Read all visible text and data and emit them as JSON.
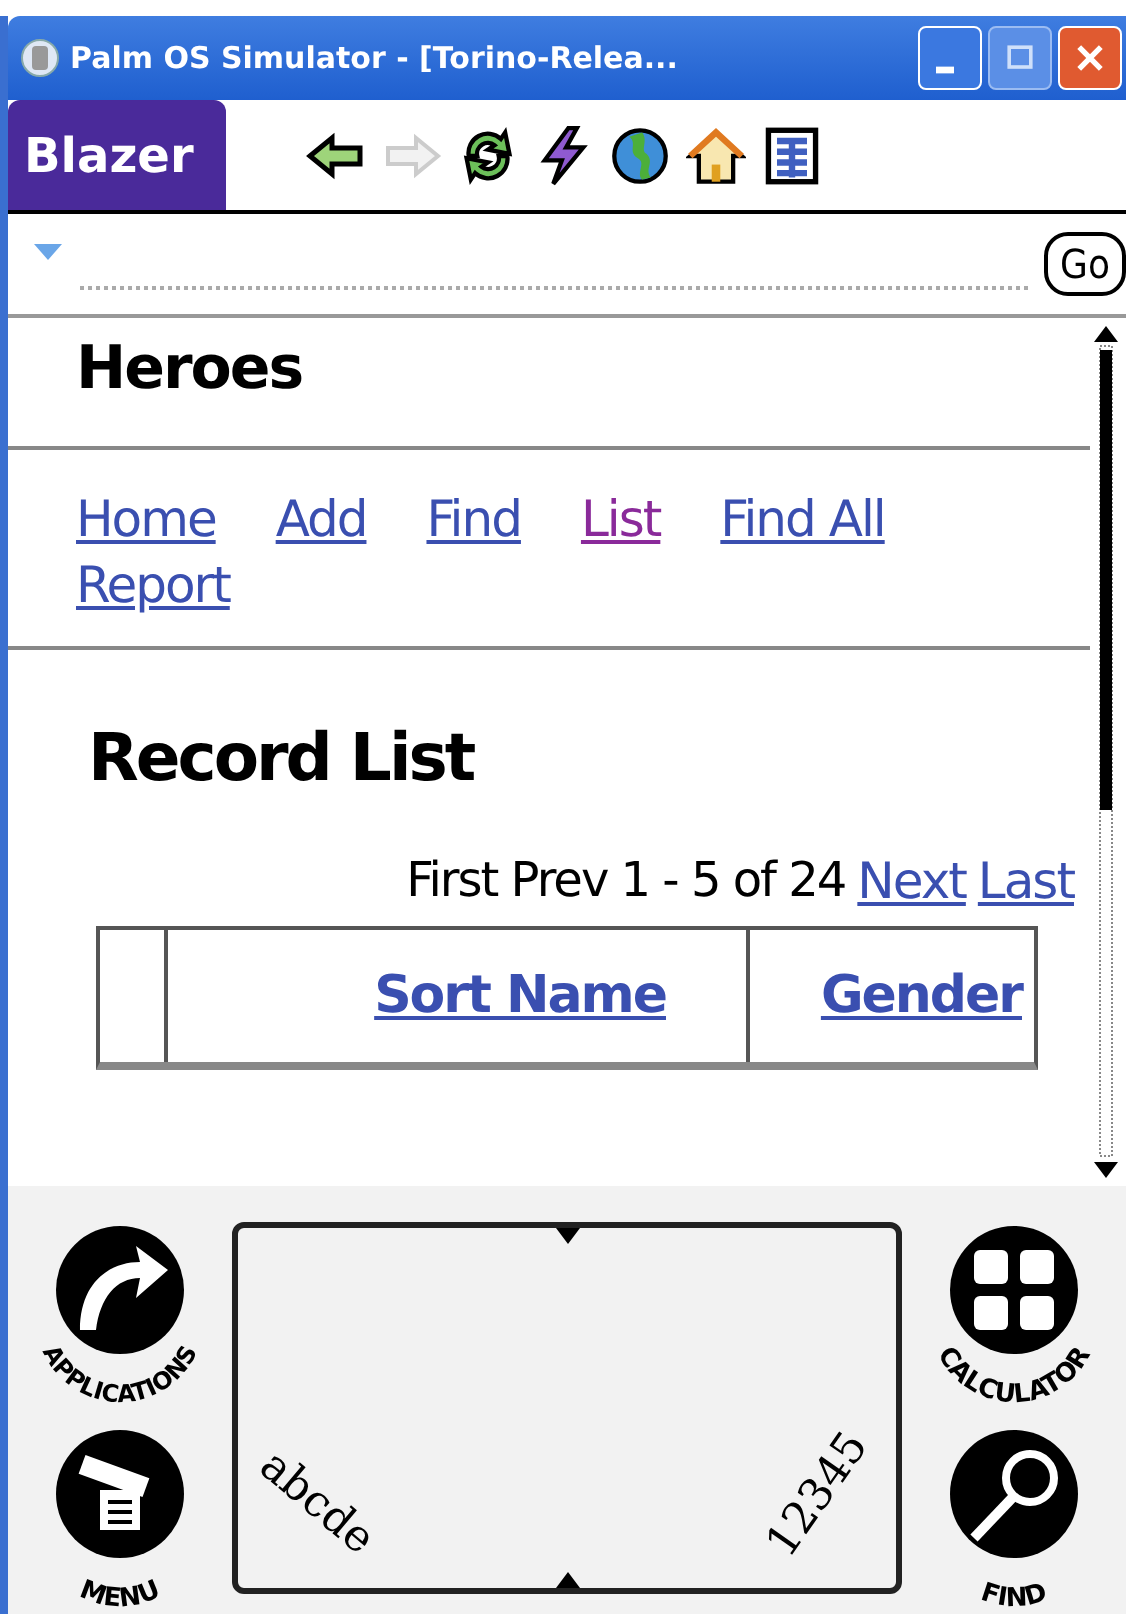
{
  "window": {
    "title": "Palm OS Simulator - [Torino-Relea..."
  },
  "toolbar": {
    "app_name": "Blazer",
    "go_label": "Go"
  },
  "page": {
    "title": "Heroes",
    "nav_links": [
      {
        "label": "Home",
        "visited": false
      },
      {
        "label": "Add",
        "visited": false
      },
      {
        "label": "Find",
        "visited": false
      },
      {
        "label": "List",
        "visited": true
      },
      {
        "label": "Find All",
        "visited": false
      },
      {
        "label": "Report",
        "visited": false
      }
    ],
    "heading": "Record List",
    "pager_text": "First Prev 1 - 5 of 24",
    "pager_links": [
      "Next",
      "Last"
    ],
    "table": {
      "columns": [
        {
          "label": "Sort Name"
        },
        {
          "label": "Gender"
        }
      ]
    }
  },
  "silkscreen": {
    "left_buttons": [
      {
        "kind": "applications",
        "label": "APPLICATIONS"
      },
      {
        "kind": "menu",
        "label": "MENU"
      }
    ],
    "right_buttons": [
      {
        "kind": "calculator",
        "label": "CALCULATOR"
      },
      {
        "kind": "find",
        "label": "FIND"
      }
    ],
    "letters_label": "abcde",
    "numbers_label": "12345"
  }
}
